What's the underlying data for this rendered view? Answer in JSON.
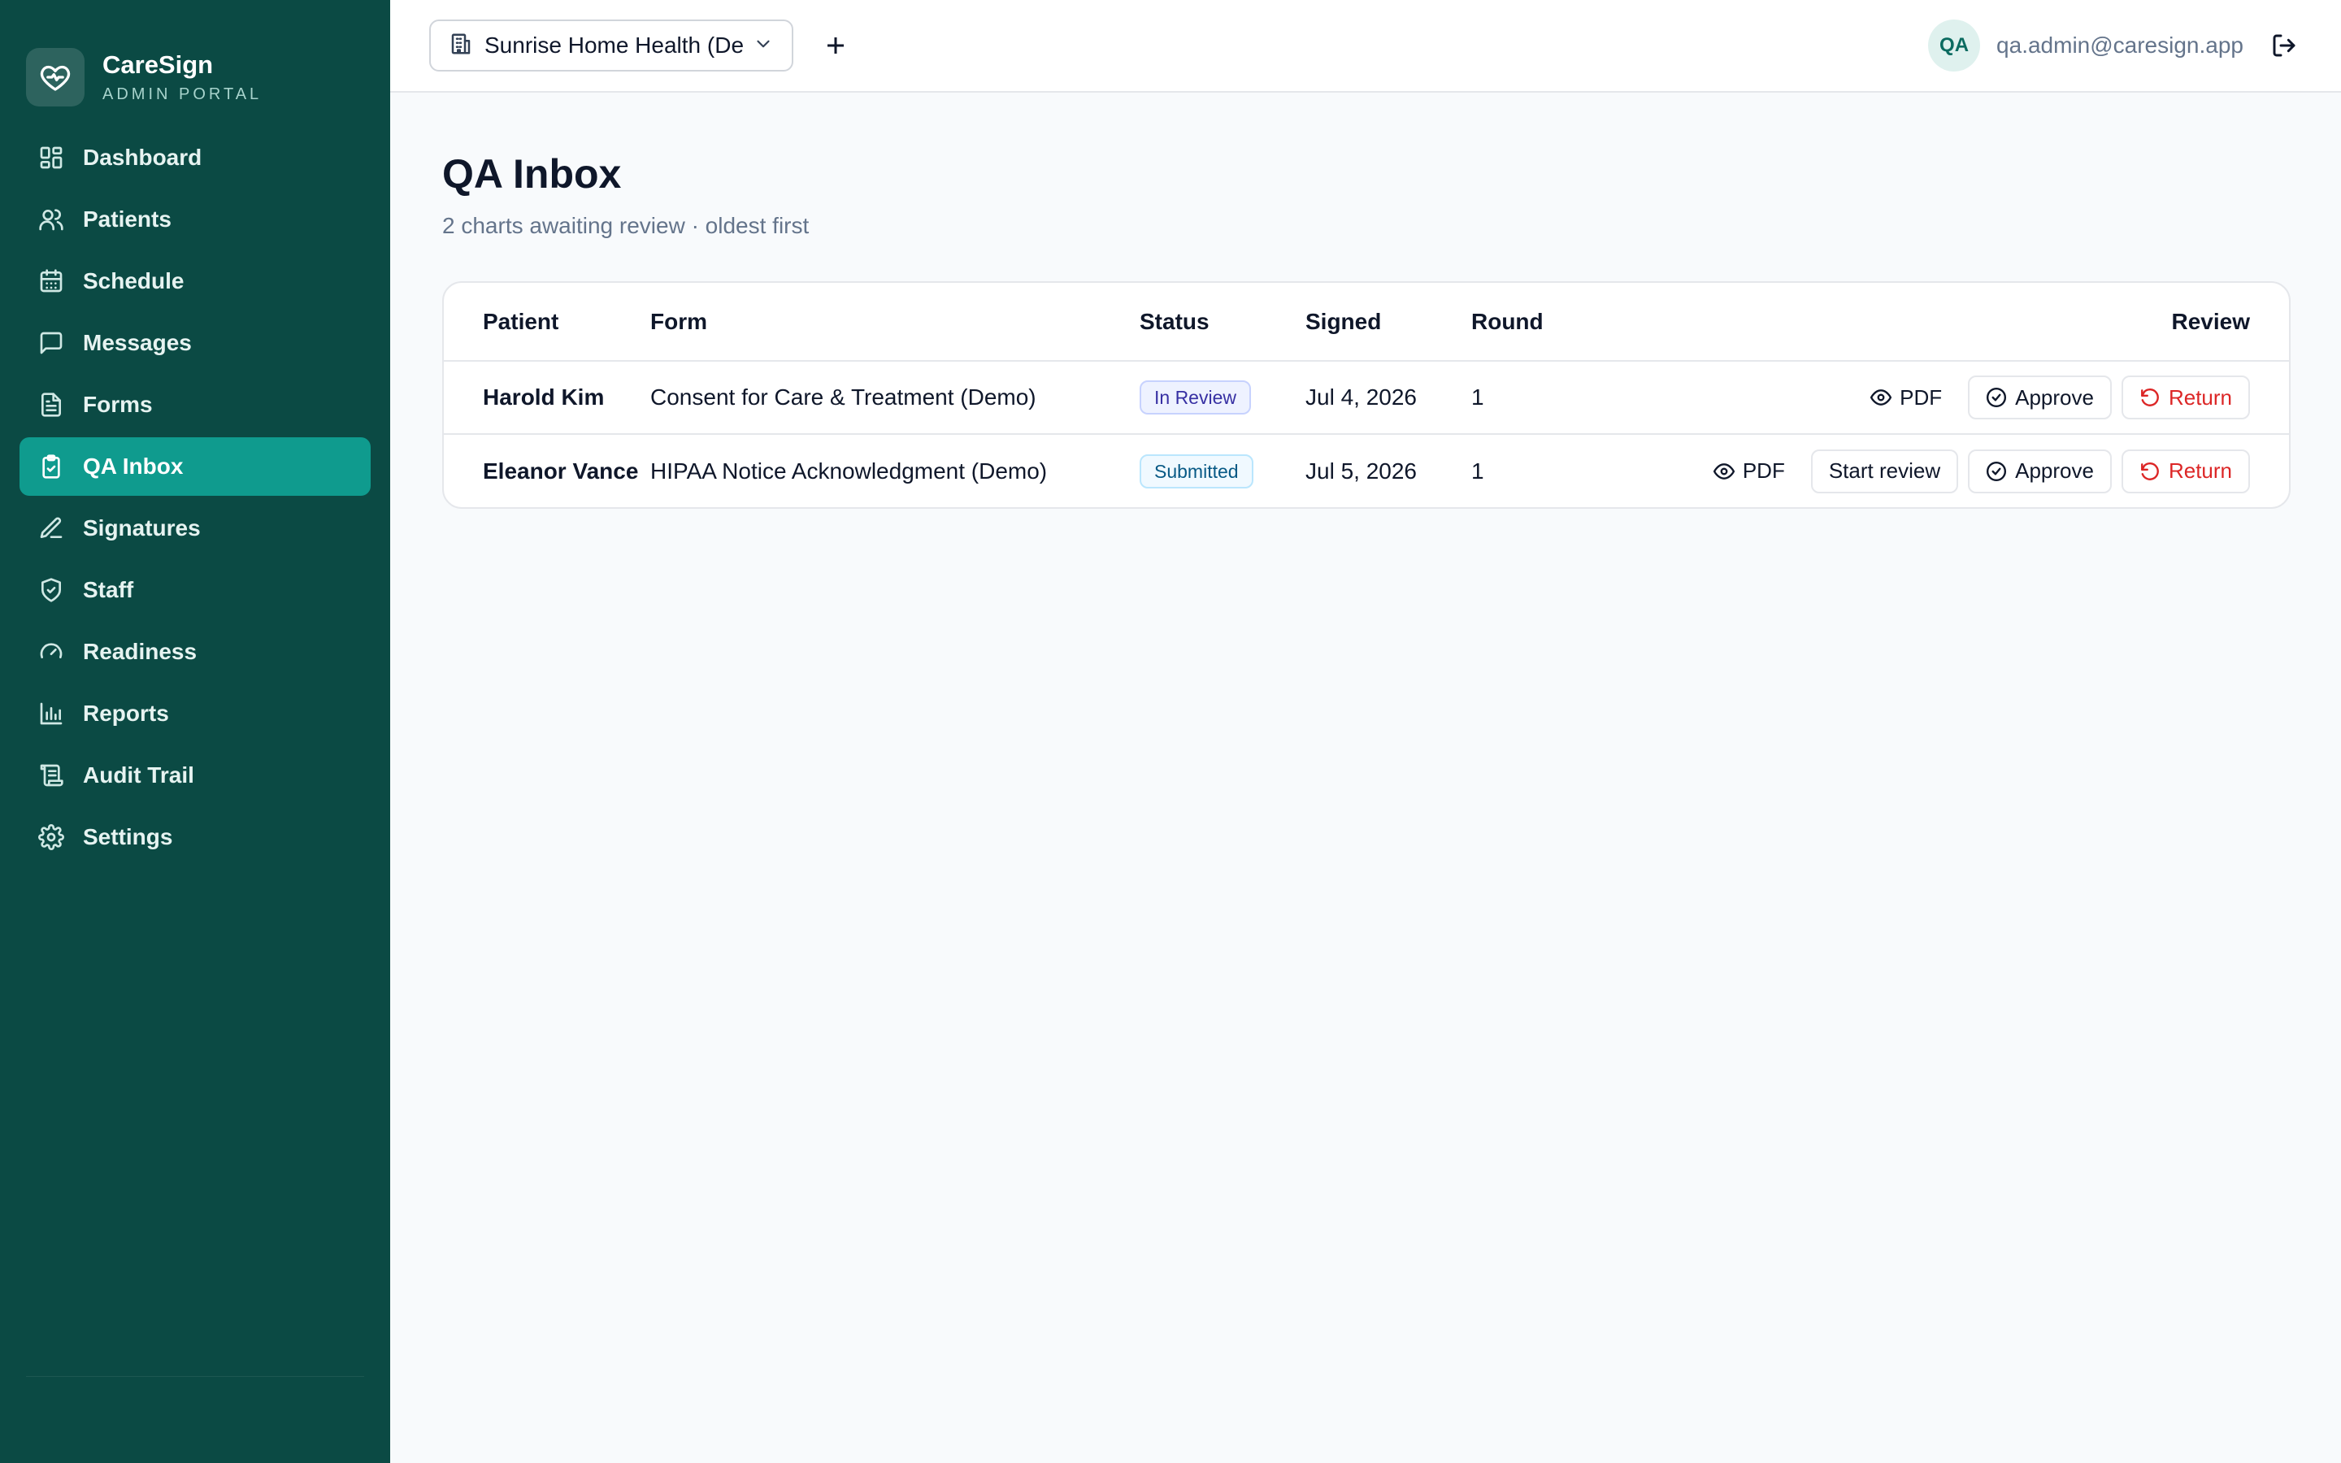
{
  "brand": {
    "name": "CareSign",
    "subtitle": "ADMIN PORTAL",
    "icon": "heart-pulse-icon"
  },
  "sidebar": {
    "items": [
      {
        "label": "Dashboard",
        "icon": "dashboard-icon",
        "active": false
      },
      {
        "label": "Patients",
        "icon": "users-icon",
        "active": false
      },
      {
        "label": "Schedule",
        "icon": "calendar-icon",
        "active": false
      },
      {
        "label": "Messages",
        "icon": "message-icon",
        "active": false
      },
      {
        "label": "Forms",
        "icon": "document-icon",
        "active": false
      },
      {
        "label": "QA Inbox",
        "icon": "clipboard-check-icon",
        "active": true
      },
      {
        "label": "Signatures",
        "icon": "pen-icon",
        "active": false
      },
      {
        "label": "Staff",
        "icon": "shield-icon",
        "active": false
      },
      {
        "label": "Readiness",
        "icon": "gauge-icon",
        "active": false
      },
      {
        "label": "Reports",
        "icon": "bar-chart-icon",
        "active": false
      },
      {
        "label": "Audit Trail",
        "icon": "scroll-icon",
        "active": false
      },
      {
        "label": "Settings",
        "icon": "gear-icon",
        "active": false
      }
    ]
  },
  "topbar": {
    "org_select": {
      "value": "Sunrise Home Health (De",
      "icon": "building-icon"
    },
    "add_icon": "plus-icon",
    "user": {
      "initials": "QA",
      "email": "qa.admin@caresign.app"
    },
    "logout_icon": "logout-icon"
  },
  "page": {
    "title": "QA Inbox",
    "subtitle": "2 charts awaiting review · oldest first"
  },
  "table": {
    "columns": {
      "patient": "Patient",
      "form": "Form",
      "status": "Status",
      "signed": "Signed",
      "round": "Round",
      "review": "Review"
    },
    "rows": [
      {
        "patient": "Harold Kim",
        "form": "Consent for Care & Treatment (Demo)",
        "status": "In Review",
        "signed": "Jul 4, 2026",
        "round": "1",
        "actions": {
          "pdf": "PDF",
          "approve": "Approve",
          "return": "Return"
        }
      },
      {
        "patient": "Eleanor Vance",
        "form": "HIPAA Notice Acknowledgment (Demo)",
        "status": "Submitted",
        "signed": "Jul 5, 2026",
        "round": "1",
        "actions": {
          "pdf": "PDF",
          "start_review": "Start review",
          "approve": "Approve",
          "return": "Return"
        }
      }
    ]
  },
  "colors": {
    "sidebar_bg": "#0b4a44",
    "active_nav": "#0f9b8e",
    "danger": "#dc2626",
    "badge_review": "#eef2ff",
    "badge_submitted": "#f0f9ff"
  }
}
